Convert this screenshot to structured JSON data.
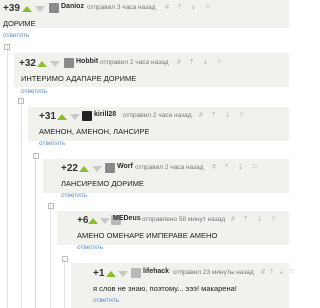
{
  "comments": [
    {
      "score": "+39",
      "user": "Danioz",
      "meta": "отправил 3 часа назад",
      "text": "ДОРИМЕ",
      "reply": "ответить",
      "icons": "# ⇡ ⇣ ⚐"
    },
    {
      "score": "+32",
      "user": "Hobbit",
      "meta": "отправил 2 часа назад",
      "text": "ИНТЕРИМО АДАПАРЕ ДОРИМЕ",
      "reply": "ответить",
      "icons": "# ⇡ ⇣ ⚐"
    },
    {
      "score": "+31",
      "user": "kirill28",
      "meta": "отправил 2 часа назад",
      "text": "АМЕНОН, АМЕНОН, ЛАНСИРЕ",
      "reply": "ответить",
      "icons": "# ⇡ ⇣ ⚐"
    },
    {
      "score": "+22",
      "user": "Worf",
      "meta": "отправил 2 часа назад",
      "text": "ЛАНСИРЕМО ДОРИМЕ",
      "reply": "ответить",
      "icons": "# ⇡ ⇣ ⚐"
    },
    {
      "score": "+6",
      "user": "MEDeus",
      "meta": "отправлено 58 минут назад",
      "text": "АМЕНО ОМЕНАРЕ ИМПЕРАВЕ АМЕНО",
      "reply": "ответить",
      "icons": "# ⇡ ⇣ ⚐"
    },
    {
      "score": "+1",
      "user": "lifehack",
      "meta": "отправил 23 минуты назад",
      "text": "я слов не знаю, поэтому... эээ! макарена!",
      "reply": "ответить",
      "icons": "# ⇡ ⇣ ⚐"
    }
  ]
}
